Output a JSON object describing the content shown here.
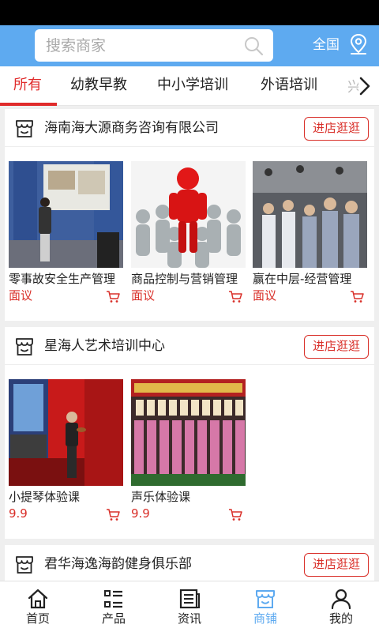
{
  "search": {
    "placeholder": "搜索商家"
  },
  "header": {
    "region": "全国"
  },
  "tabs": [
    {
      "label": "所有",
      "active": true
    },
    {
      "label": "幼教早教"
    },
    {
      "label": "中小学培训"
    },
    {
      "label": "外语培训"
    },
    {
      "label": "兴"
    }
  ],
  "stores": [
    {
      "name": "海南海大源商务咨询有限公司",
      "enter_label": "进店逛逛",
      "products": [
        {
          "name": "零事故安全生产管理",
          "price": "面议"
        },
        {
          "name": "商品控制与营销管理",
          "price": "面议"
        },
        {
          "name": "赢在中层-经营管理",
          "price": "面议"
        }
      ]
    },
    {
      "name": "星海人艺术培训中心",
      "enter_label": "进店逛逛",
      "products": [
        {
          "name": "小提琴体验课",
          "price": "9.9"
        },
        {
          "name": "声乐体验课",
          "price": "9.9"
        }
      ]
    },
    {
      "name": "君华海逸海韵健身俱乐部",
      "enter_label": "进店逛逛"
    }
  ],
  "bottom_nav": [
    {
      "label": "首页"
    },
    {
      "label": "产品"
    },
    {
      "label": "资讯"
    },
    {
      "label": "商铺",
      "active": true
    },
    {
      "label": "我的"
    }
  ],
  "colors": {
    "header": "#5eaaf0",
    "accent_red": "#d9302a",
    "active_nav": "#5eaaf0"
  }
}
